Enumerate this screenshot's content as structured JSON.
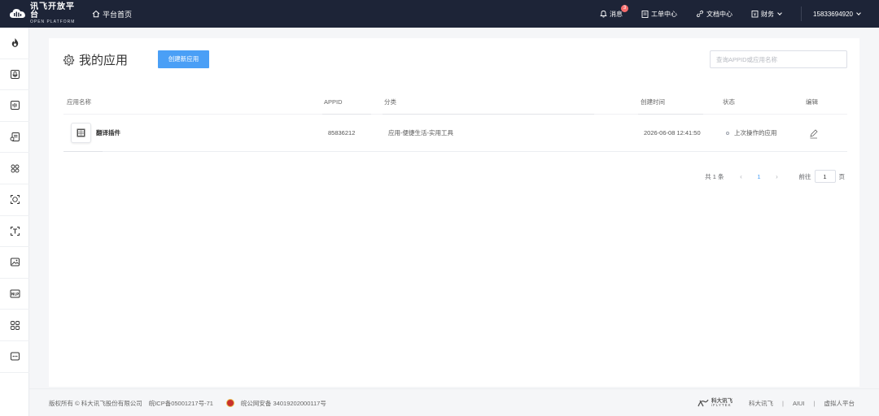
{
  "topbar": {
    "logo_cn": "讯飞开放平台",
    "logo_en": "OPEN PLATFORM",
    "home": "平台首页",
    "messages": "消息",
    "messages_count": "3",
    "tickets": "工单中心",
    "docs": "文档中心",
    "finance": "财务",
    "user": "15833694920"
  },
  "sidebar": {
    "items": [
      {
        "icon": "flame-icon"
      },
      {
        "icon": "voice-dictation-icon"
      },
      {
        "icon": "speech-synthesis-icon"
      },
      {
        "icon": "voice-transcribe-icon"
      },
      {
        "icon": "multimodal-icon"
      },
      {
        "icon": "face-scan-icon"
      },
      {
        "icon": "text-recognition-icon"
      },
      {
        "icon": "image-recognition-icon"
      },
      {
        "icon": "nlp-icon"
      },
      {
        "icon": "apps-grid-icon"
      },
      {
        "icon": "more-icon"
      }
    ],
    "nlp_label": "NLP"
  },
  "page": {
    "title": "我的应用",
    "create_button": "创建新应用",
    "search_placeholder": "查询APPID或应用名称"
  },
  "table": {
    "headers": {
      "name": "应用名称",
      "appid": "APPID",
      "category": "分类",
      "created": "创建时间",
      "status": "状态",
      "edit": "编辑"
    },
    "rows": [
      {
        "name": "翻译插件",
        "appid": "85836212",
        "category": "应用-便捷生活-实用工具",
        "created": "2026-06-08 12:41:50",
        "status": "上次操作的应用"
      }
    ]
  },
  "pagination": {
    "total": "共 1 条",
    "prev": "‹",
    "page": "1",
    "next": "›",
    "goto_label": "前往",
    "goto_value": "1",
    "page_suffix": "页"
  },
  "footer": {
    "copyright": "版权所有 © 科大讯飞股份有限公司",
    "icp": "皖ICP备05001217号-71",
    "police": "皖公网安备 34019202000117号",
    "brand_cn": "科大讯飞",
    "brand_en": "iFLYTEK",
    "links": [
      "科大讯飞",
      "AIUI",
      "虚拟人平台"
    ]
  },
  "colors": {
    "topbar_bg": "#1d2437",
    "primary": "#4a9ff6",
    "badge": "#f56c6c"
  }
}
